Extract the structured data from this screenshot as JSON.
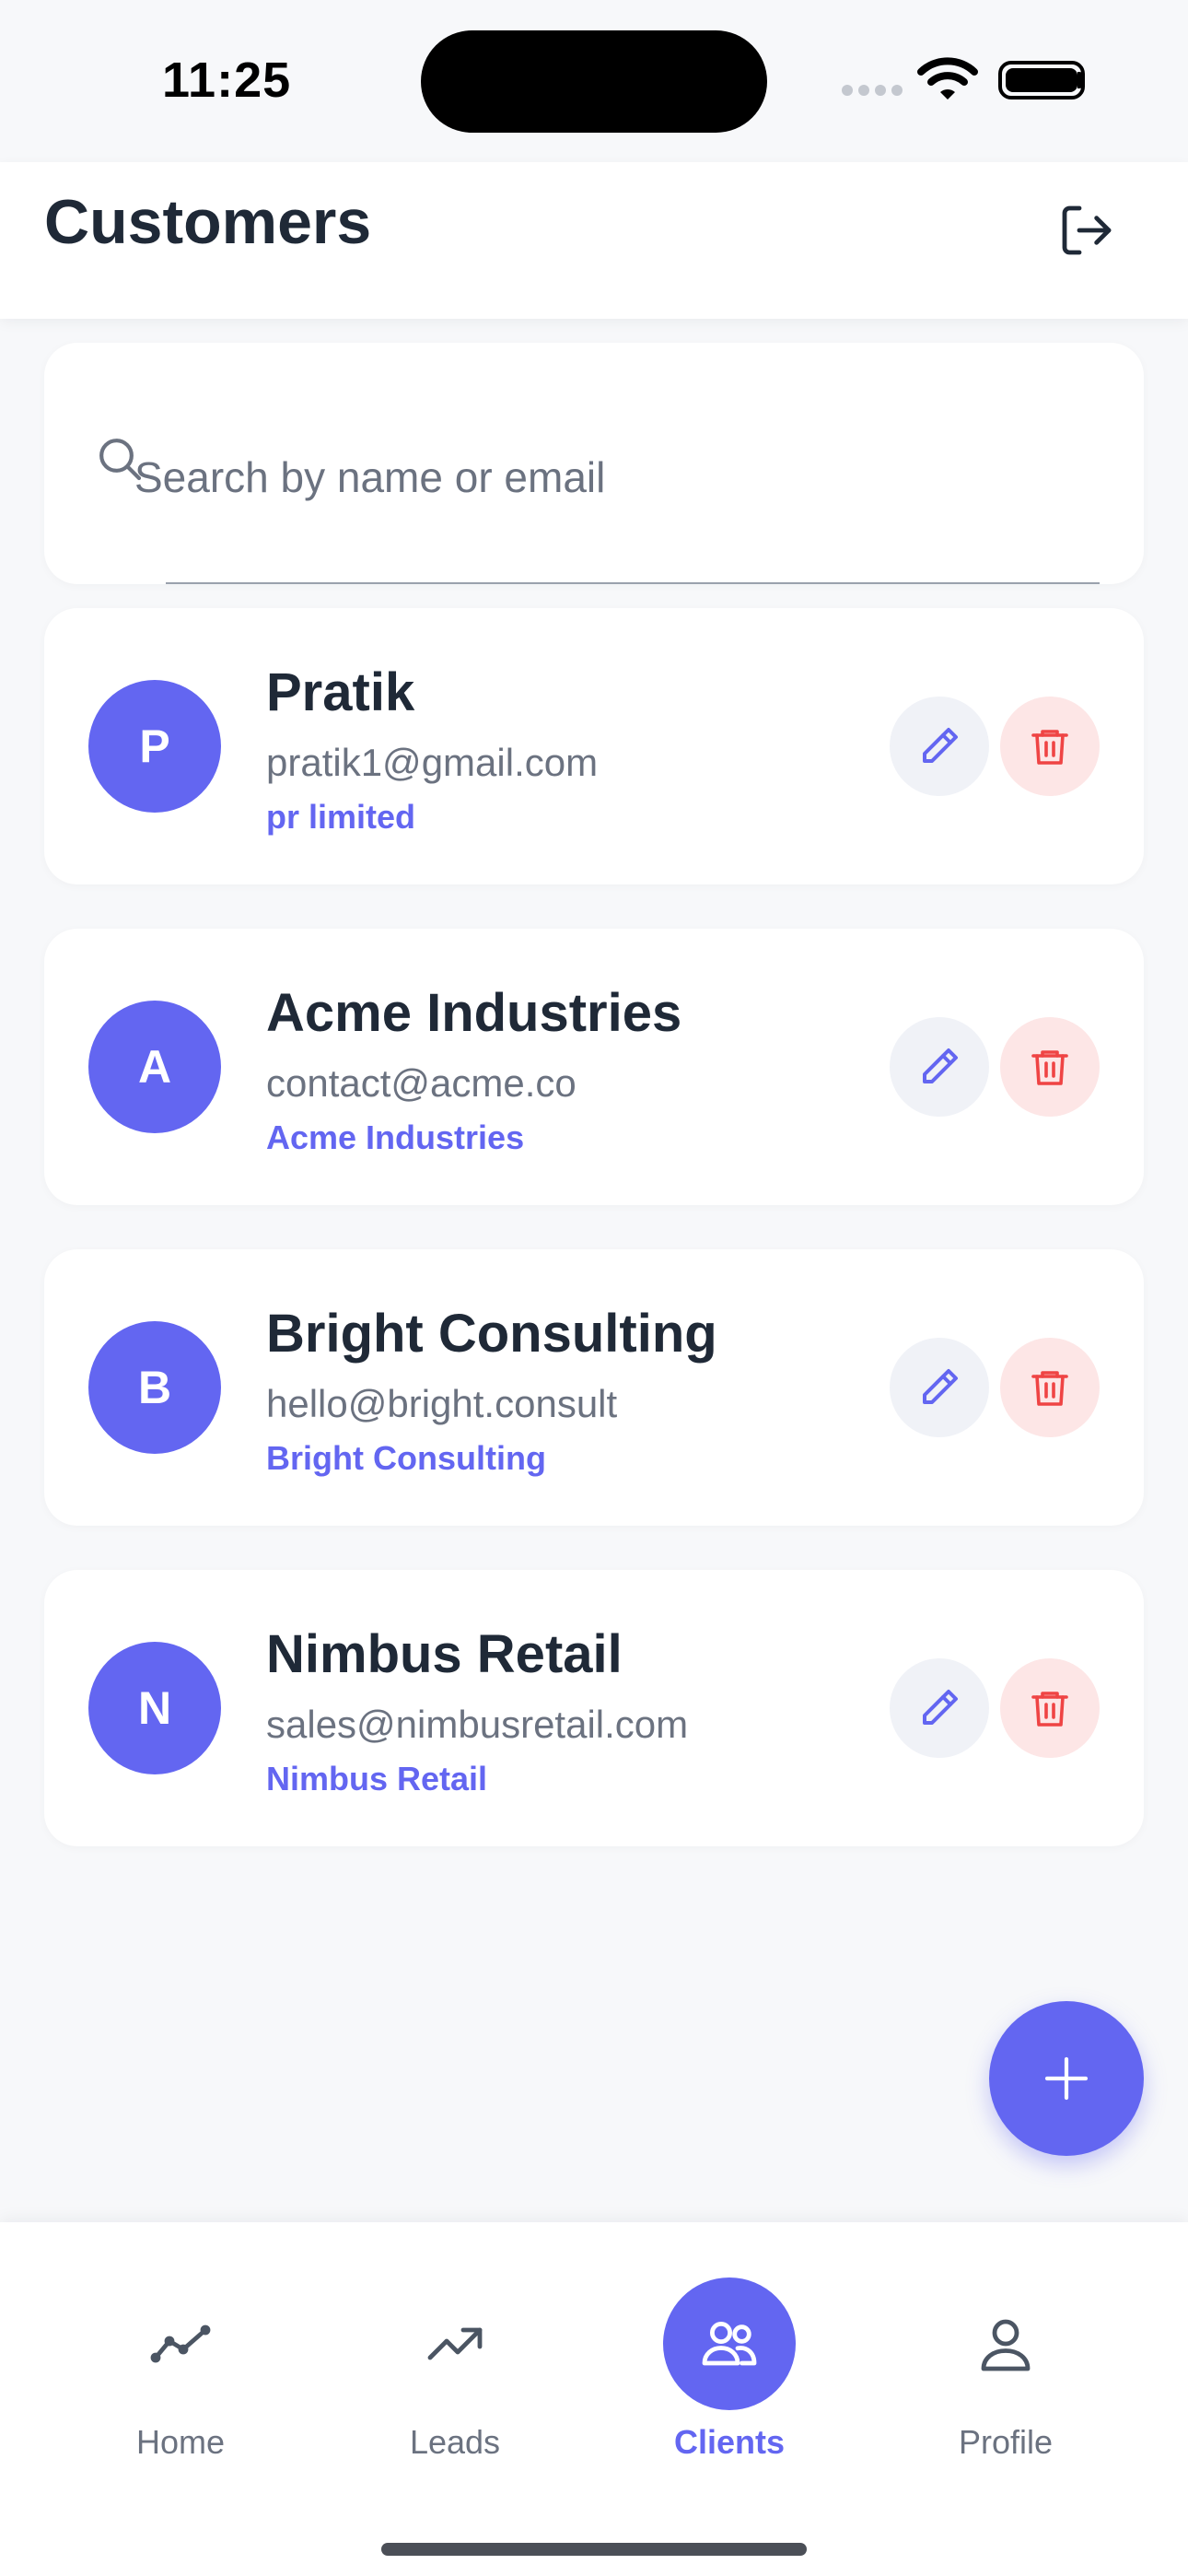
{
  "status_bar": {
    "time": "11:25"
  },
  "header": {
    "title": "Customers",
    "logout_icon": "logout-icon"
  },
  "search": {
    "placeholder": "Search by name or email",
    "value": ""
  },
  "customers": [
    {
      "initial": "P",
      "name": "Pratik",
      "email": "pratik1@gmail.com",
      "company": "pr limited"
    },
    {
      "initial": "A",
      "name": "Acme Industries",
      "email": "contact@acme.co",
      "company": "Acme Industries"
    },
    {
      "initial": "B",
      "name": "Bright Consulting",
      "email": "hello@bright.consult",
      "company": "Bright Consulting"
    },
    {
      "initial": "N",
      "name": "Nimbus Retail",
      "email": "sales@nimbusretail.com",
      "company": "Nimbus Retail"
    }
  ],
  "fab": {
    "icon": "plus-icon"
  },
  "nav": {
    "items": [
      {
        "label": "Home",
        "icon": "activity-icon",
        "active": false
      },
      {
        "label": "Leads",
        "icon": "trending-up-icon",
        "active": false
      },
      {
        "label": "Clients",
        "icon": "users-icon",
        "active": true
      },
      {
        "label": "Profile",
        "icon": "user-icon",
        "active": false
      }
    ]
  },
  "colors": {
    "accent": "#6366f1",
    "danger": "#ef4444",
    "danger_bg": "#fde6e6",
    "text": "#1f2937",
    "muted": "#6b7280",
    "background": "#f7f8fa"
  }
}
